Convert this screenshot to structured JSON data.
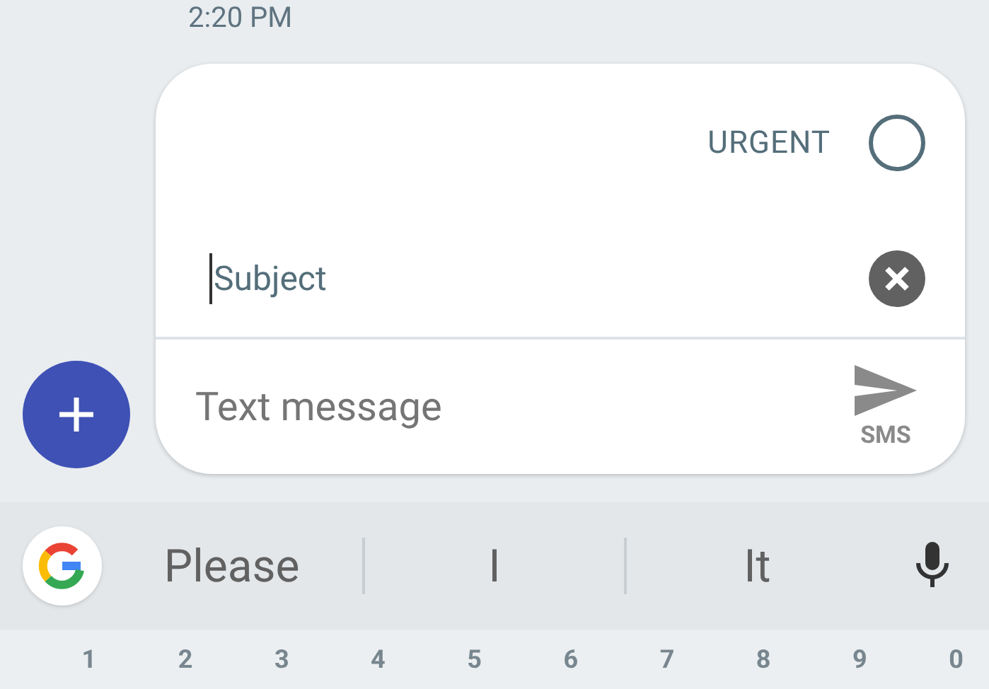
{
  "timestamp": "2:20 PM",
  "compose": {
    "urgent": {
      "label": "URGENT",
      "checked": false
    },
    "subject": {
      "placeholder": "Subject"
    },
    "message": {
      "placeholder": "Text message"
    },
    "send_label": "SMS"
  },
  "suggestions": [
    "Please",
    "I",
    "It"
  ],
  "key_hints": [
    "1",
    "2",
    "3",
    "4",
    "5",
    "6",
    "7",
    "8",
    "9",
    "0"
  ]
}
